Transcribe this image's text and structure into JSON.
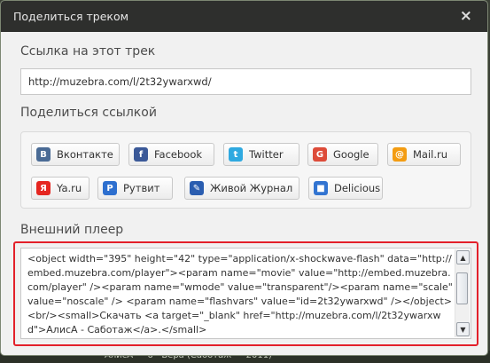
{
  "dialog": {
    "title": "Поделиться треком",
    "close_symbol": "×"
  },
  "link_section": {
    "label": "Ссылка на этот трек",
    "url": "http://muzebra.com/l/2t32ywarxwd/"
  },
  "share_section": {
    "label": "Поделиться ссылкой",
    "buttons": [
      {
        "label": "Вконтакте",
        "icon": "vkontakte-icon",
        "glyph": "B",
        "color": "#4a6b95"
      },
      {
        "label": "Facebook",
        "icon": "facebook-icon",
        "glyph": "f",
        "color": "#3b5998"
      },
      {
        "label": "Twitter",
        "icon": "twitter-icon",
        "glyph": "t",
        "color": "#2fa9e0"
      },
      {
        "label": "Google",
        "icon": "google-icon",
        "glyph": "G",
        "color": "#dd4b39"
      },
      {
        "label": "Mail.ru",
        "icon": "mailru-icon",
        "glyph": "@",
        "color": "#f39c12"
      },
      {
        "label": "Ya.ru",
        "icon": "yaru-icon",
        "glyph": "Я",
        "color": "#e52620"
      },
      {
        "label": "Рутвит",
        "icon": "rutvit-icon",
        "glyph": "P",
        "color": "#2d6fcf"
      },
      {
        "label": "Живой Журнал",
        "icon": "livejournal-icon",
        "glyph": "✎",
        "color": "#2a5db0"
      },
      {
        "label": "Delicious",
        "icon": "delicious-icon",
        "glyph": "■",
        "color": "#3274d1"
      }
    ]
  },
  "embed_section": {
    "label": "Внешний плеер",
    "code": "<object width=\"395\" height=\"42\" type=\"application/x-shockwave-flash\" data=\"http://embed.muzebra.com/player\"><param name=\"movie\" value=\"http://embed.muzebra.com/player\" /><param name=\"wmode\" value=\"transparent\"/><param name=\"scale\" value=\"noscale\" /> <param name=\"flashvars\" value=\"id=2t32ywarxwd\" /></object><br/><small>Скачать <a target=\"_blank\" href=\"http://muzebra.com/l/2t32ywarxwd\">АлисА - Саботаж</a>.</small>"
  },
  "backdrop": {
    "partial_text": "АлисА — 6 · Вера (Саботаж — 2011)"
  }
}
